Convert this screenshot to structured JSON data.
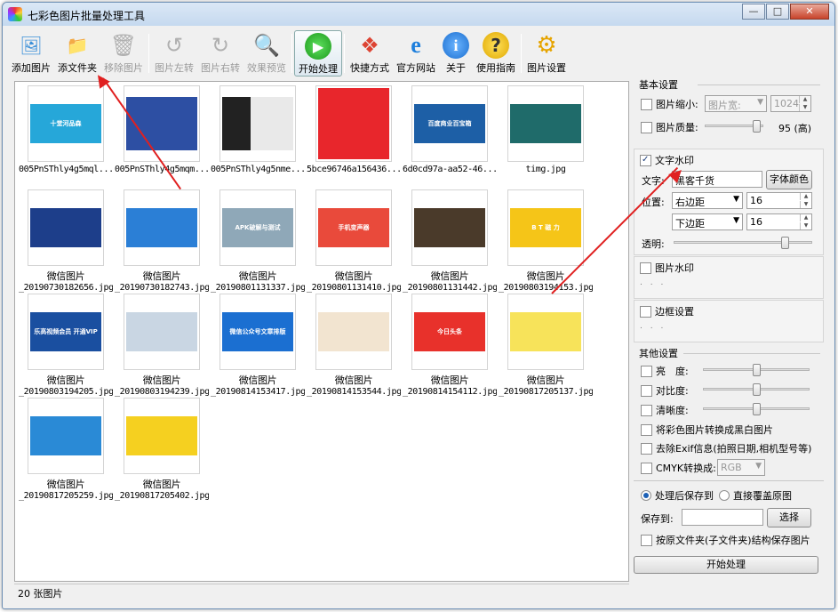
{
  "app": {
    "title": "七彩色图片批量处理工具",
    "window_buttons": {
      "minimize": "—",
      "maximize": "□",
      "close": "✕"
    }
  },
  "toolbar": [
    {
      "label": "添加图片",
      "icon": "add-image-icon",
      "enabled": true
    },
    {
      "label": "添文件夹",
      "icon": "add-folder-icon",
      "enabled": true
    },
    {
      "label": "移除图片",
      "icon": "remove-image-icon",
      "enabled": false
    },
    {
      "label": "图片左转",
      "icon": "rotate-left-icon",
      "enabled": false
    },
    {
      "label": "图片右转",
      "icon": "rotate-right-icon",
      "enabled": false
    },
    {
      "label": "效果预览",
      "icon": "magnifier-icon",
      "enabled": false
    },
    {
      "label": "开始处理",
      "icon": "play-icon",
      "enabled": true
    },
    {
      "label": "快捷方式",
      "icon": "shortcut-cubes-icon",
      "enabled": true
    },
    {
      "label": "官方网站",
      "icon": "ie-browser-icon",
      "enabled": true
    },
    {
      "label": "关于",
      "icon": "info-icon",
      "enabled": true
    },
    {
      "label": "使用指南",
      "icon": "help-icon",
      "enabled": true
    },
    {
      "label": "图片设置",
      "icon": "gear-icon",
      "enabled": true
    }
  ],
  "thumbnails": [
    {
      "line1": "",
      "line2": "005PnSThly4g5mql...",
      "thumb_text": "十堂河品森",
      "bg": "#26a7d9"
    },
    {
      "line1": "",
      "line2": "005PnSThly4g5mqm...",
      "thumb_text": "",
      "bg": "#2d4fa3"
    },
    {
      "line1": "",
      "line2": "005PnSThly4g5nme...",
      "thumb_text": "",
      "bg": "#7a6a5a"
    },
    {
      "line1": "",
      "line2": "5bce96746a156436...",
      "thumb_text": "",
      "bg": "#e8262c"
    },
    {
      "line1": "",
      "line2": "6d0cd97a-aa52-46...",
      "thumb_text": "百度商业百宝箱",
      "bg": "#1d5fa6"
    },
    {
      "line1": "",
      "line2": "timg.jpg",
      "thumb_text": "",
      "bg": "#1f6b6a"
    },
    {
      "line1": "微信图片",
      "line2": "_20190730182656.jpg",
      "thumb_text": "",
      "bg": "#1d3e8a"
    },
    {
      "line1": "微信图片",
      "line2": "_20190730182743.jpg",
      "thumb_text": "",
      "bg": "#2b7fd6"
    },
    {
      "line1": "微信图片",
      "line2": "_20190801131337.jpg",
      "thumb_text": "APK破解与测试",
      "bg": "#8fa8b8"
    },
    {
      "line1": "微信图片",
      "line2": "_20190801131410.jpg",
      "thumb_text": "手机变声器",
      "bg": "#e94a3b"
    },
    {
      "line1": "微信图片",
      "line2": "_20190801131442.jpg",
      "thumb_text": "",
      "bg": "#4a3a2a"
    },
    {
      "line1": "微信图片",
      "line2": "_20190803194153.jpg",
      "thumb_text": "B T 磁 力",
      "bg": "#f5c518"
    },
    {
      "line1": "微信图片",
      "line2": "_20190803194205.jpg",
      "thumb_text": "乐高视频会员 开通VIP",
      "bg": "#1a4fa0"
    },
    {
      "line1": "微信图片",
      "line2": "_20190803194239.jpg",
      "thumb_text": "",
      "bg": "#c9d6e3"
    },
    {
      "line1": "微信图片",
      "line2": "_20190814153417.jpg",
      "thumb_text": "微信公众号文章排版",
      "bg": "#1b6fd1"
    },
    {
      "line1": "微信图片",
      "line2": "_20190814153544.jpg",
      "thumb_text": "",
      "bg": "#f2e4d0"
    },
    {
      "line1": "微信图片",
      "line2": "_20190814154112.jpg",
      "thumb_text": "今日头条",
      "bg": "#e8312b"
    },
    {
      "line1": "微信图片",
      "line2": "_20190817205137.jpg",
      "thumb_text": "",
      "bg": "#f7e35a"
    },
    {
      "line1": "微信图片",
      "line2": "_20190817205259.jpg",
      "thumb_text": "",
      "bg": "#2a8ad6"
    },
    {
      "line1": "微信图片",
      "line2": "_20190817205402.jpg",
      "thumb_text": "",
      "bg": "#f5d020"
    }
  ],
  "status": {
    "count_text": "20 张图片"
  },
  "settings": {
    "basic": {
      "header": "基本设置",
      "resize": {
        "label": "图片缩小:",
        "checked": false,
        "mode": "图片宽:",
        "value": "1024"
      },
      "quality": {
        "label": "图片质量:",
        "checked": false,
        "value_text": "95 (高)",
        "level": 0.95
      }
    },
    "text_watermark": {
      "header": "文字水印",
      "checked": true,
      "text_label": "文字:",
      "text_value": "黑客千货",
      "font_color_button": "字体颜色",
      "position_label": "位置:",
      "h_align": "右边距",
      "h_offset": "16",
      "v_align": "下边距",
      "v_offset": "16",
      "opacity_label": "透明:",
      "opacity_level": 0.82
    },
    "image_watermark": {
      "header": "图片水印",
      "checked": false,
      "dots": ". . ."
    },
    "border": {
      "header": "边框设置",
      "checked": false,
      "dots": ". . ."
    },
    "other": {
      "header": "其他设置",
      "brightness": {
        "label": "亮　度:",
        "checked": false,
        "level": 0.5
      },
      "contrast": {
        "label": "对比度:",
        "checked": false,
        "level": 0.5
      },
      "sharpness": {
        "label": "清晰度:",
        "checked": false,
        "level": 0.5
      },
      "grayscale": {
        "label": "将彩色图片转换成黑白图片",
        "checked": false
      },
      "exif": {
        "label": "去除Exif信息(拍照日期,相机型号等)",
        "checked": false
      },
      "cmyk": {
        "label": "CMYK转换成:",
        "checked": false,
        "value": "RGB"
      }
    },
    "save": {
      "opt_save": "处理后保存到",
      "opt_overwrite": "直接覆盖原图",
      "save_to_label": "保存到:",
      "save_to_value": "",
      "browse_button": "选择",
      "keep_structure": {
        "label": "按原文件夹(子文件夹)结构保存图片",
        "checked": false
      }
    },
    "start_button": "开始处理"
  },
  "colors": {
    "annotation": "#e02020",
    "accent": "#1b5fb5"
  }
}
